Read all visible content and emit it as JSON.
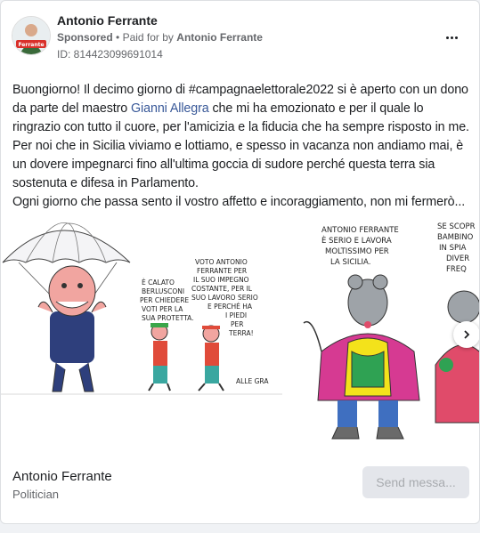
{
  "post": {
    "author": "Antonio Ferrante",
    "sponsored": "Sponsored",
    "separator": "•",
    "paid_for_prefix": "Paid for by",
    "paid_for_name": "Antonio Ferrante",
    "ad_id": "ID: 814423099691014",
    "avatar_badge": "Ferrante",
    "text": {
      "seg1": "Buongiorno! Il decimo giorno di #campagnaelettorale2022 si è aperto con un dono da parte del maestro ",
      "link": "Gianni Allegra",
      "seg2": " che mi ha emozionato e per il quale lo ringrazio con tutto il cuore, per l'amicizia e la fiducia che ha sempre risposto in me. Per noi che in Sicilia viviamo e lottiamo, e spesso in vacanza non andiamo mai, è un dovere impegnarci fino all'ultima goccia di sudore perché questa terra sia sostenuta e difesa in Parlamento.",
      "para2": "Ogni giorno che passa sento il vostro affetto e incoraggiamento, non mi fermerò..."
    }
  },
  "cartoon1": {
    "bubble1": [
      "È CALATO",
      "BERLUSCONI",
      "PER CHIEDERE",
      "VOTI PER LA",
      "SUA PROTETTA."
    ],
    "bubble2": [
      "VOTO ANTONIO",
      "FERRANTE PER",
      "IL SUO IMPEGNO",
      "COSTANTE, PER IL",
      "SUO LAVORO SERIO",
      "E PERCHÉ HA",
      "I PIEDI",
      "PER",
      "TERRA!"
    ],
    "signature": "ALLE GRA"
  },
  "cartoon2": {
    "caption1": [
      "ANTONIO FERRANTE",
      "È SERIO E LAVORA",
      "MOLTISSIMO PER",
      "LA SICILIA."
    ],
    "caption2": [
      "SE SCOPR",
      "BAMBINO",
      "IN SPIA",
      "DIVER",
      "FREQ"
    ]
  },
  "footer": {
    "name": "Antonio Ferrante",
    "category": "Politician",
    "cta": "Send messa..."
  },
  "colors": {
    "link": "#385898",
    "muted": "#65676b",
    "cta_bg": "#e4e6eb"
  }
}
